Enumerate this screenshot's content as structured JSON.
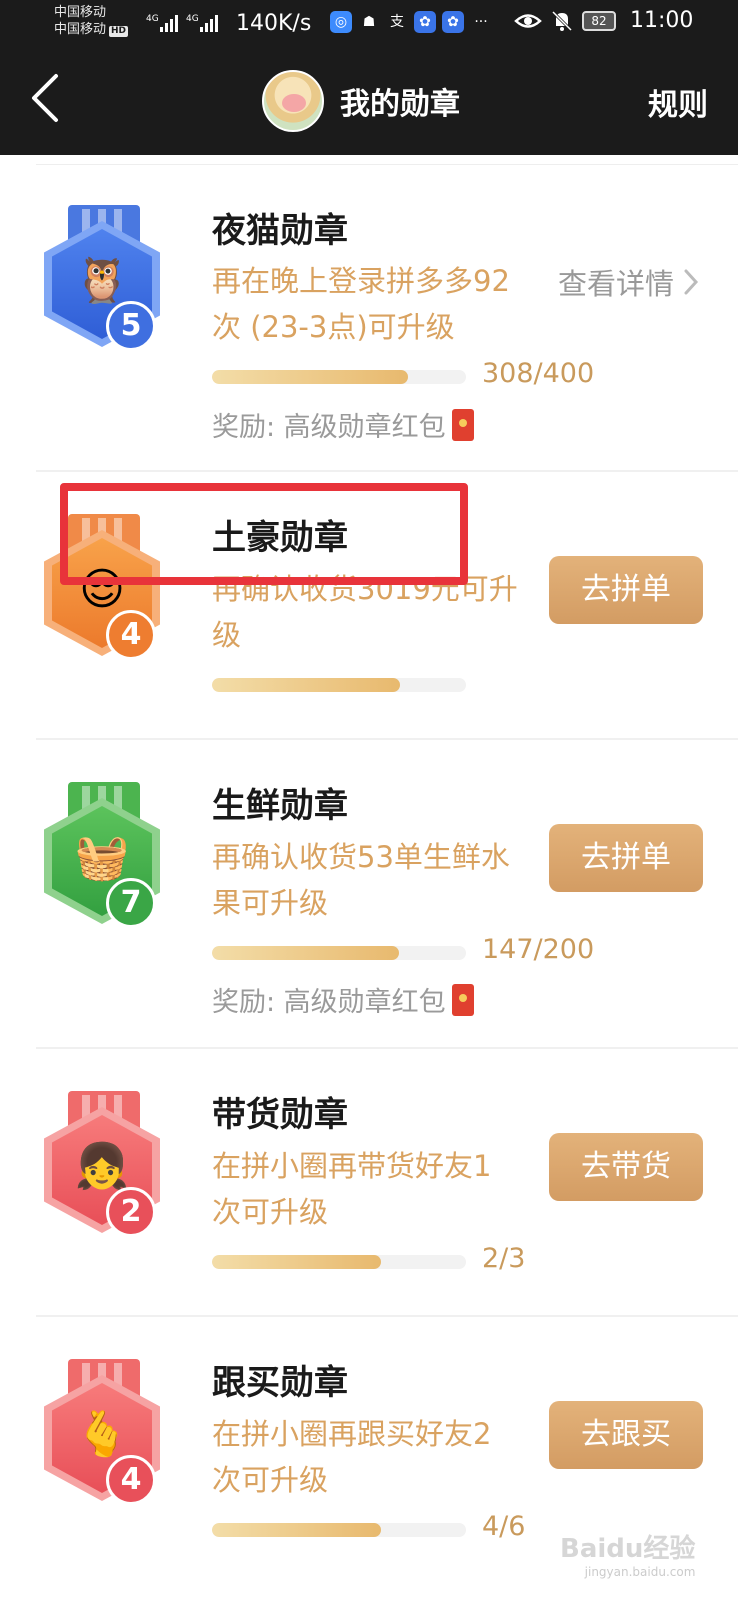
{
  "status_bar": {
    "carrier_1": "中国移动",
    "carrier_2": "中国移动",
    "hd": "HD",
    "net_1": "4G",
    "net_2": "4G",
    "speed": "140K/s",
    "app_icons": [
      "app-notification-icon",
      "qq-icon",
      "alipay-icon",
      "baidu-icon",
      "baidu-icon"
    ],
    "more": "···",
    "battery": "82",
    "time": "11:00"
  },
  "nav": {
    "title": "我的勋章",
    "rules": "规则"
  },
  "colors": {
    "accent": "#d9a260",
    "button": "#d8a26a",
    "highlight": "#e8333a",
    "header_bg": "#1b1b1b"
  },
  "badges": [
    {
      "title": "夜猫勋章",
      "desc": "再在晚上登录拼多多92次 (23-3点)可升级",
      "level": "5",
      "icon": "owl-icon",
      "progress_text": "308/400",
      "progress": 0.77,
      "reward": "奖励: 高级勋章红包",
      "link": "查看详情",
      "button": ""
    },
    {
      "title": "土豪勋章",
      "desc": "再确认收货3019元可升级",
      "level": "4",
      "icon": "rich-man-icon",
      "progress_text": "",
      "progress": 0.74,
      "reward": "",
      "link": "",
      "button": "去拼单"
    },
    {
      "title": "生鲜勋章",
      "desc": "再确认收货53单生鲜水果可升级",
      "level": "7",
      "icon": "fruit-basket-icon",
      "progress_text": "147/200",
      "progress": 0.735,
      "reward": "奖励: 高级勋章红包",
      "link": "",
      "button": "去拼单"
    },
    {
      "title": "带货勋章",
      "desc": "在拼小圈再带货好友1次可升级",
      "level": "2",
      "icon": "girl-heart-icon",
      "progress_text": "2/3",
      "progress": 0.667,
      "reward": "",
      "link": "",
      "button": "去带货"
    },
    {
      "title": "跟买勋章",
      "desc": "在拼小圈再跟买好友2次可升级",
      "level": "4",
      "icon": "hand-heart-icon",
      "progress_text": "4/6",
      "progress": 0.667,
      "reward": "",
      "link": "",
      "button": "去跟买"
    }
  ],
  "watermark": {
    "brand": "Baidu经验",
    "url": "jingyan.baidu.com"
  }
}
